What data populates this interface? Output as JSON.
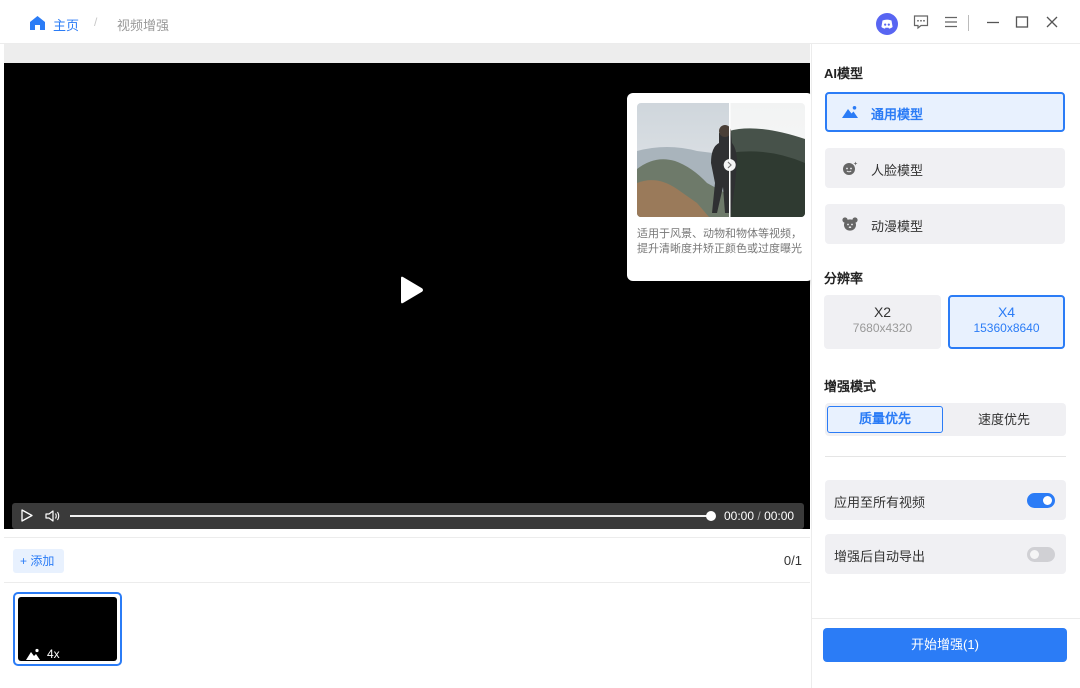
{
  "breadcrumb": {
    "home": "主页",
    "separator": "/",
    "current": "视频增强"
  },
  "titlebar_icons": [
    "discord-icon",
    "feedback-icon",
    "menu-icon",
    "minimize-icon",
    "maximize-icon",
    "close-icon"
  ],
  "player": {
    "time_current": "00:00",
    "time_separator": "/",
    "time_total": "00:00",
    "progress": 1.0
  },
  "tooltip": {
    "text": "适用于风景、动物和物体等视频，提升清晰度并矫正颜色或过度曝光"
  },
  "list": {
    "add_label": "+ 添加",
    "counter": "0/1"
  },
  "thumbnail": {
    "label": "4x"
  },
  "panel": {
    "ai_model_title": "AI模型",
    "models": [
      {
        "label": "通用模型",
        "icon": "landscape-icon",
        "active": true
      },
      {
        "label": "人脸模型",
        "icon": "face-icon",
        "active": false
      },
      {
        "label": "动漫模型",
        "icon": "anime-icon",
        "active": false
      }
    ],
    "resolution_title": "分辨率",
    "resolutions": [
      {
        "scale": "X2",
        "size": "7680x4320",
        "active": false
      },
      {
        "scale": "X4",
        "size": "15360x8640",
        "active": true
      }
    ],
    "mode_title": "增强模式",
    "modes": [
      {
        "label": "质量优先",
        "active": true
      },
      {
        "label": "速度优先",
        "active": false
      }
    ],
    "apply_all": {
      "label": "应用至所有视频",
      "on": true
    },
    "auto_export": {
      "label": "增强后自动导出",
      "on": false
    },
    "start_button": "开始增强(1)"
  },
  "colors": {
    "accent": "#2b7cf6",
    "accent_bg": "#e8f1fe",
    "discord": "#5865f2"
  }
}
